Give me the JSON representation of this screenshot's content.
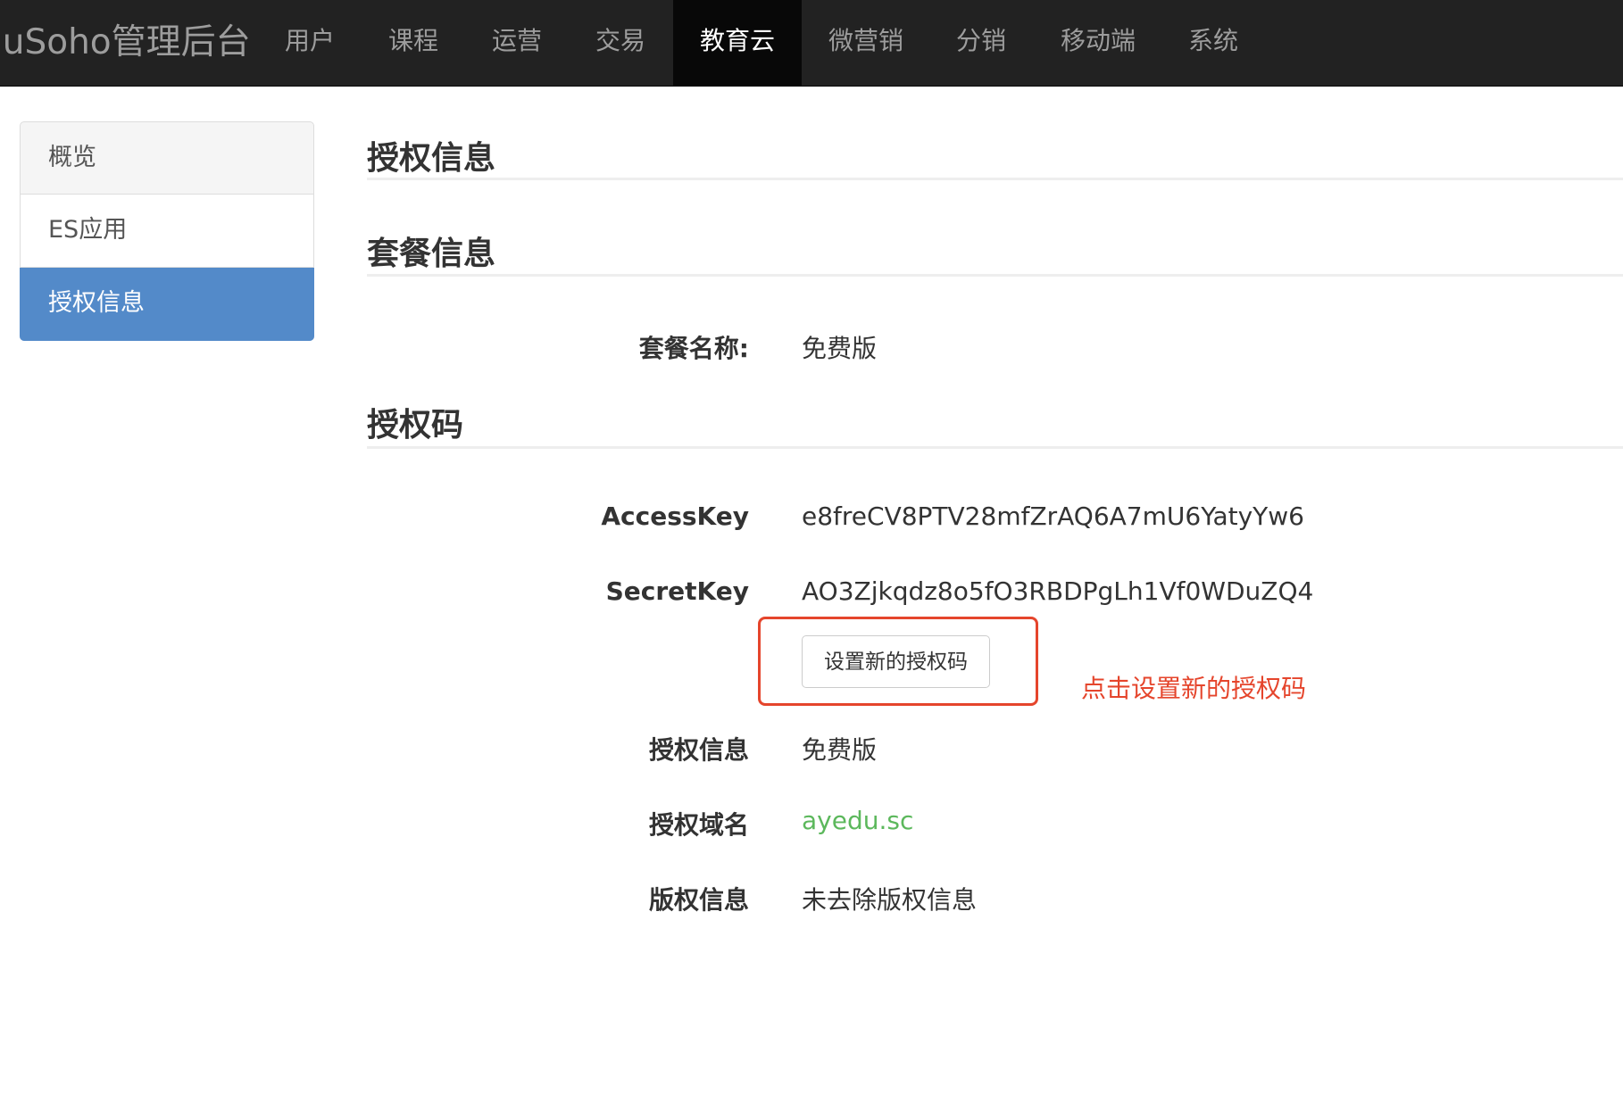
{
  "brand": "duSoho管理后台",
  "nav": {
    "items": [
      {
        "label": "用户"
      },
      {
        "label": "课程"
      },
      {
        "label": "运营"
      },
      {
        "label": "交易"
      },
      {
        "label": "教育云"
      },
      {
        "label": "微营销"
      },
      {
        "label": "分销"
      },
      {
        "label": "移动端"
      },
      {
        "label": "系统"
      }
    ],
    "active": "教育云"
  },
  "sidebar": {
    "items": [
      {
        "label": "概览"
      },
      {
        "label": "ES应用"
      },
      {
        "label": "授权信息"
      }
    ],
    "active": "授权信息"
  },
  "main": {
    "page_title": "授权信息",
    "package_section": {
      "title": "套餐信息",
      "name_label": "套餐名称:",
      "name_value": "免费版"
    },
    "license_section": {
      "title": "授权码",
      "access_key_label": "AccessKey",
      "access_key_value": "e8freCV8PTV28mfZrAQ6A7mU6YatyYw6",
      "secret_key_label": "SecretKey",
      "secret_key_value": "AO3Zjkqdz8o5fO3RBDPgLh1Vf0WDuZQ4",
      "set_new_button": "设置新的授权码",
      "auth_info_label": "授权信息",
      "auth_info_value": "免费版",
      "auth_domain_label": "授权域名",
      "auth_domain_value": "ayedu.sc",
      "copyright_label": "版权信息",
      "copyright_value": "未去除版权信息"
    }
  },
  "annotation": {
    "text": "点击设置新的授权码",
    "color": "#e5452c"
  },
  "colors": {
    "navbar_bg": "#222222",
    "nav_active_bg": "#080808",
    "sidebar_active": "#538ac9",
    "link_green": "#5cb85c"
  }
}
